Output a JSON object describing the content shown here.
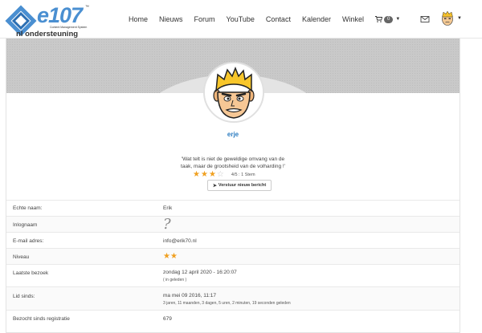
{
  "brand": {
    "logo_text": "e107",
    "tm": "™",
    "subtitle": "Content Management System",
    "community": "nl ondersteuning"
  },
  "nav": {
    "items": [
      "Home",
      "Nieuws",
      "Forum",
      "YouTube",
      "Contact",
      "Kalender",
      "Winkel"
    ],
    "cart_count": "0",
    "icons": {
      "cart": "cart-icon",
      "mail": "mail-icon",
      "caret": "chevron-down-icon"
    }
  },
  "profile": {
    "username": "erje",
    "quote": "'Wat telt is niet de geweldige omvang van de taak, maar de grootsheid van de volharding !'",
    "rating": {
      "stars": 3,
      "max": 4,
      "text": "4/5 : 1 Stem"
    },
    "message_button": "Verstuur nieuw bericht"
  },
  "details": [
    {
      "label": "Echte naam:",
      "value": "Erik"
    },
    {
      "label": "Inlognaam",
      "value": "?"
    },
    {
      "label": "E-mail adres:",
      "value": "info@erik70.nl"
    },
    {
      "label": "Niveau",
      "value": "★★"
    },
    {
      "label": "Laatste bezoek",
      "value": "zondag 12 april 2020 - 16:20:07",
      "sub": "( in geleden )"
    },
    {
      "label": "Lid sinds:",
      "value": "ma mei 09 2016, 11:17",
      "sub": "3 jaren, 11 maanden, 3 dagen, 5 uren, 2 minuten, 19 seconden geleden"
    },
    {
      "label": "Bezocht sinds registratie",
      "value": "679"
    }
  ],
  "colors": {
    "accent": "#2a7bc0",
    "star": "#f0a020",
    "logo": "#4a8fd1"
  }
}
